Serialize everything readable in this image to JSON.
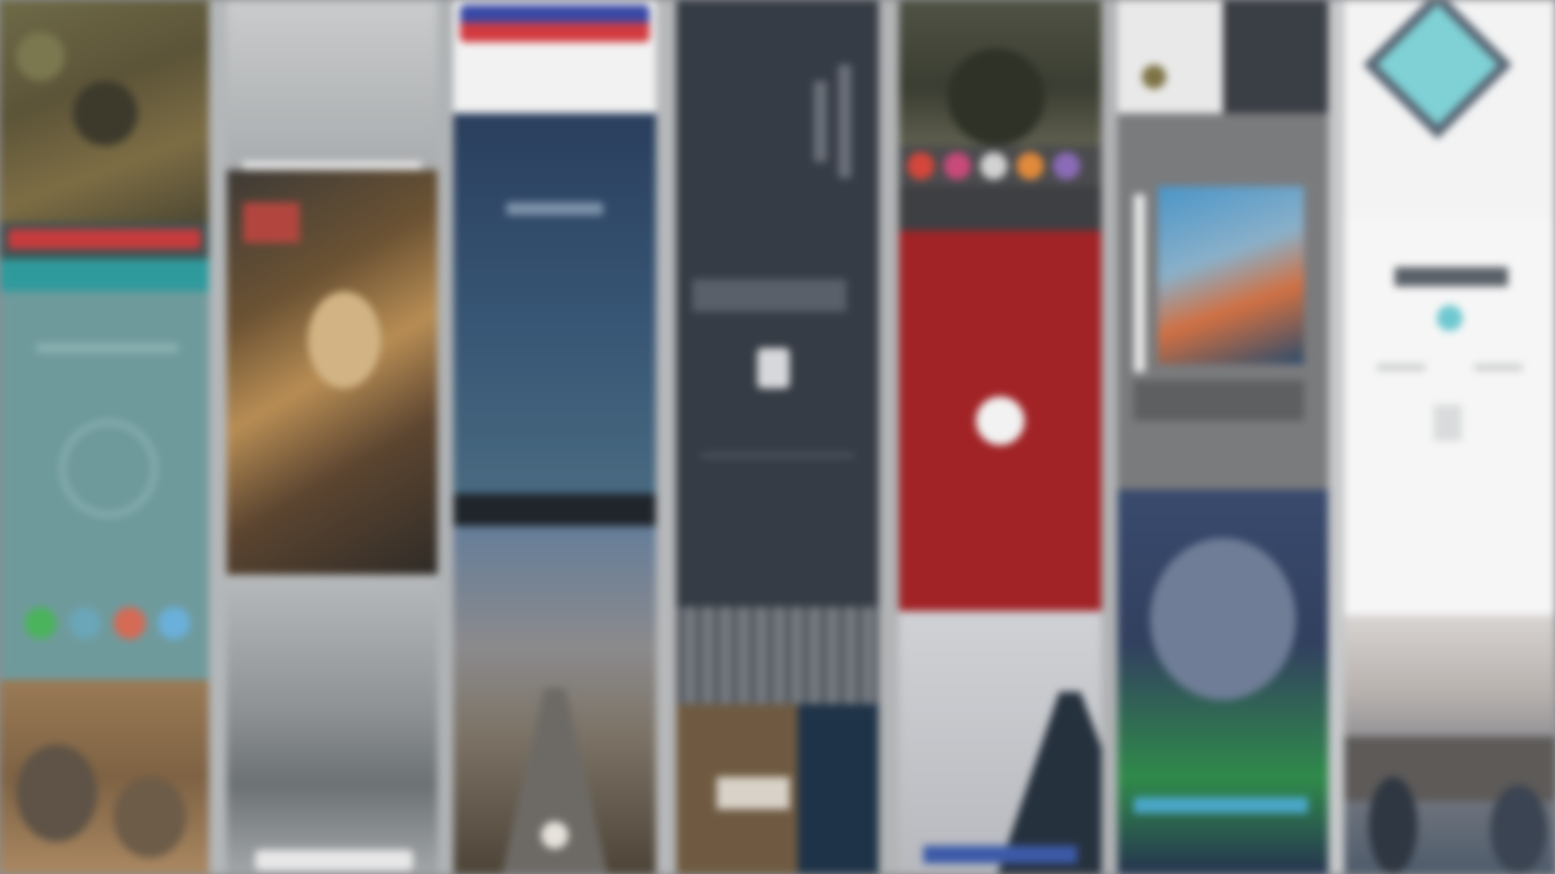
{
  "canvas": {
    "description_free": true
  },
  "columns": [
    {
      "id": "col-1",
      "tiles": [
        "painting-crowd",
        "red-banner-app",
        "teal-call-screen",
        "desert-rocks"
      ]
    },
    {
      "id": "col-2",
      "tiles": [
        "grey-sky",
        "liberty-painting",
        "foggy-mountains"
      ]
    },
    {
      "id": "col-3",
      "tiles": [
        "flag-header",
        "blue-gradient-screen",
        "pier-sunset"
      ]
    },
    {
      "id": "col-4",
      "tiles": [
        "dark-stats-screen",
        "dark-grid-screen",
        "door-photo"
      ]
    },
    {
      "id": "col-5",
      "tiles": [
        "tree-photo",
        "color-dots-strip",
        "red-play-screen",
        "grey-silhouette"
      ]
    },
    {
      "id": "col-6",
      "tiles": [
        "camera-photo",
        "photo-gallery-card",
        "astronaut-photo"
      ]
    },
    {
      "id": "col-7",
      "tiles": [
        "diamond-logo",
        "light-app-screen",
        "cityscape-photo"
      ]
    }
  ],
  "colors": {
    "background": "#8d8f92",
    "red_accent": "#a12326",
    "teal": "#6f9a9c",
    "navy": "#2b3d55",
    "dark_panel": "#363c45",
    "diamond_teal": "#7fd1d5"
  },
  "icons": [
    "phone-icon",
    "play-icon",
    "lock-icon",
    "diamond-logo-icon",
    "document-icon"
  ]
}
